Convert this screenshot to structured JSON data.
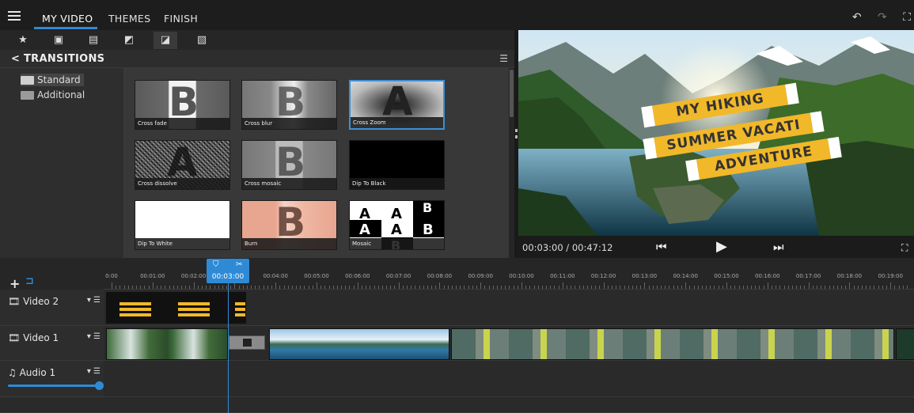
{
  "menu": {
    "items": [
      {
        "label": "MY VIDEO",
        "active": true
      },
      {
        "label": "THEMES",
        "active": false
      },
      {
        "label": "FINISH",
        "active": false
      }
    ],
    "undo_icon": "undo-icon",
    "redo_icon": "redo-icon"
  },
  "toolbar": {
    "icons": [
      "star-icon",
      "folder-media-icon",
      "text-icon",
      "filter-icon",
      "transition-icon",
      "overlay-icon"
    ],
    "active": 4
  },
  "transitions": {
    "header": "< TRANSITIONS",
    "categories": [
      {
        "label": "Standard",
        "active": true
      },
      {
        "label": "Additional",
        "active": false
      }
    ],
    "items": [
      {
        "label": "Cross fade",
        "letter": "B"
      },
      {
        "label": "Cross blur",
        "letter": "B"
      },
      {
        "label": "Cross Zoom",
        "letter": "A",
        "selected": true
      },
      {
        "label": "Cross dissolve",
        "letter": "A"
      },
      {
        "label": "Cross mosaic",
        "letter": "B"
      },
      {
        "label": "Dip To Black",
        "letter": ""
      },
      {
        "label": "Dip To White",
        "letter": ""
      },
      {
        "label": "Burn",
        "letter": "B"
      },
      {
        "label": "Mosaic",
        "letter": "A"
      }
    ]
  },
  "preview": {
    "banner_lines": [
      "MY HIKING",
      "SUMMER VACATI",
      "ADVENTURE"
    ],
    "time": "00:03:00 / 00:47:12",
    "accent": "#f1b829"
  },
  "timeline": {
    "playhead_time": "00:03:00",
    "ticks": [
      "0:00",
      "00:01:00",
      "00:02:00",
      "00:03:00",
      "00:04:00",
      "00:05:00",
      "00:06:00",
      "00:07:00",
      "00:08:00",
      "00:09:00",
      "00:10:00",
      "00:11:00",
      "00:12:00",
      "00:13:00",
      "00:14:00",
      "00:15:00",
      "00:16:00",
      "00:17:00",
      "00:18:00",
      "00:19:00"
    ],
    "tracks": [
      {
        "name": "Video 2",
        "icon": "film-icon"
      },
      {
        "name": "Video 1",
        "icon": "film-icon"
      },
      {
        "name": "Audio 1",
        "icon": "music-note-icon"
      }
    ],
    "accent": "#2f8ad6"
  }
}
